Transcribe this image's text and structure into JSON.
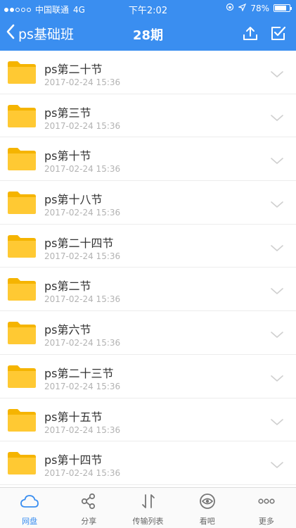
{
  "status_bar": {
    "carrier": "中国联通",
    "network": "4G",
    "time": "下午2:02",
    "battery": "78%",
    "battery_level": 0.78
  },
  "nav": {
    "back_label": "ps基础班",
    "title": "28期"
  },
  "folders": [
    {
      "name": "ps第二十节",
      "date": "2017-02-24 15:36"
    },
    {
      "name": "ps第三节",
      "date": "2017-02-24 15:36"
    },
    {
      "name": "ps第十节",
      "date": "2017-02-24 15:36"
    },
    {
      "name": "ps第十八节",
      "date": "2017-02-24 15:36"
    },
    {
      "name": "ps第二十四节",
      "date": "2017-02-24 15:36"
    },
    {
      "name": "ps第二节",
      "date": "2017-02-24 15:36"
    },
    {
      "name": "ps第六节",
      "date": "2017-02-24 15:36"
    },
    {
      "name": "ps第二十三节",
      "date": "2017-02-24 15:36"
    },
    {
      "name": "ps第十五节",
      "date": "2017-02-24 15:36"
    },
    {
      "name": "ps第十四节",
      "date": "2017-02-24 15:36"
    }
  ],
  "tabs": [
    {
      "label": "网盘",
      "icon": "cloud-icon",
      "active": true
    },
    {
      "label": "分享",
      "icon": "share-icon",
      "active": false
    },
    {
      "label": "传输列表",
      "icon": "transfer-icon",
      "active": false
    },
    {
      "label": "看吧",
      "icon": "eye-icon",
      "active": false
    },
    {
      "label": "更多",
      "icon": "more-icon",
      "active": false
    }
  ],
  "colors": {
    "accent": "#3a8ef0",
    "folder": "#ffc933",
    "folder_tab": "#f5b400"
  }
}
